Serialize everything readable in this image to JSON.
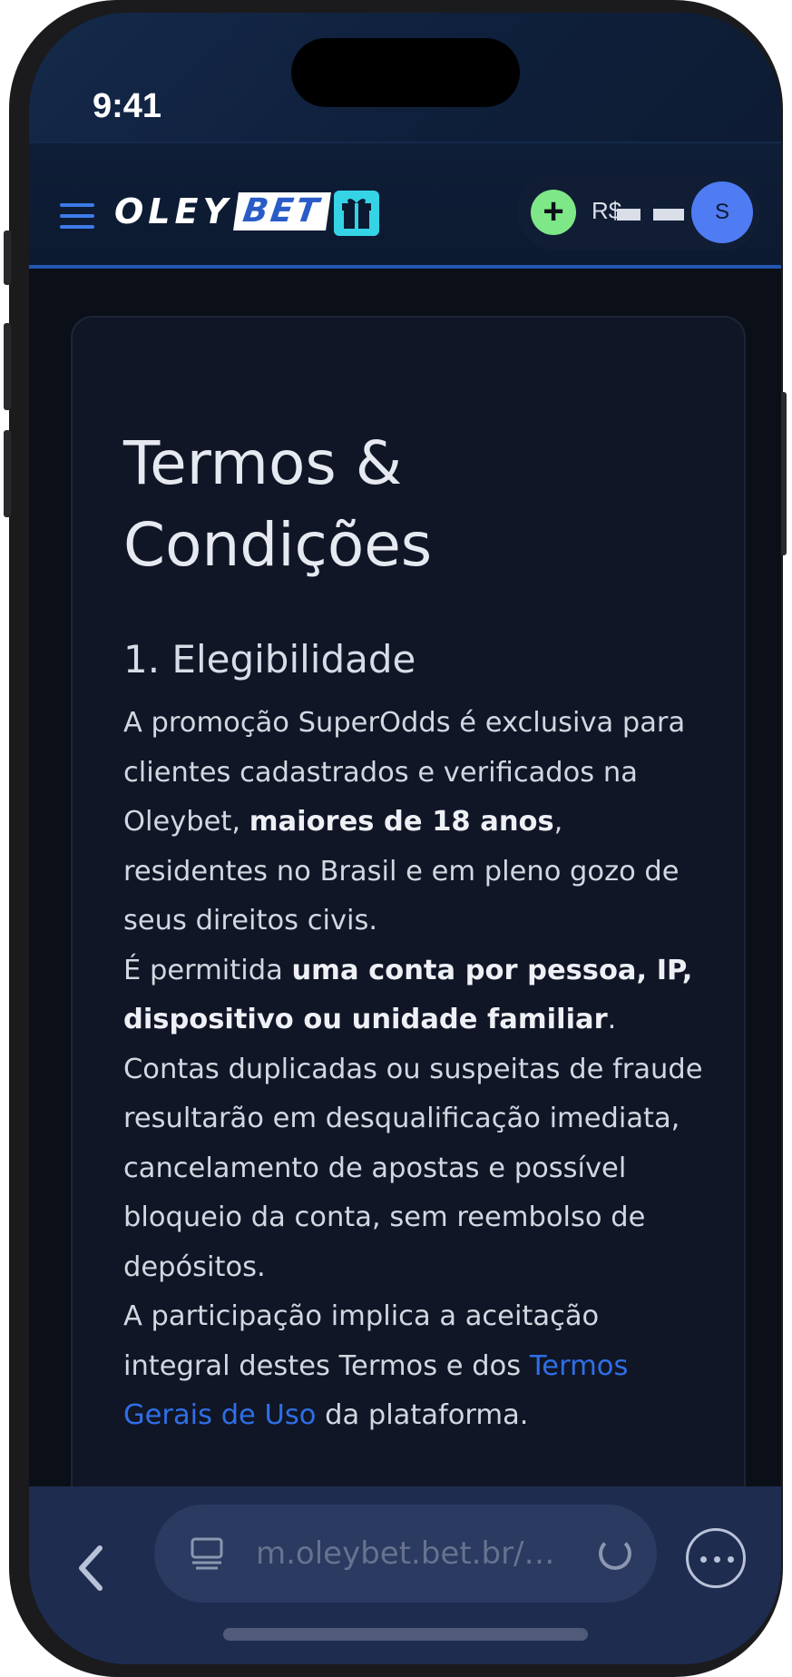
{
  "status": {
    "time": "9:41"
  },
  "header": {
    "logo_left": "OLEY",
    "logo_right": "BET",
    "deposit_symbol": "+",
    "currency": "R$",
    "avatar_initial": "S"
  },
  "page": {
    "title": "Termos & Condições",
    "section1": {
      "heading": "1. Elegibilidade",
      "p1_a": "A promoção SuperOdds é exclusiva para clientes cadastrados e verificados na Oleybet, ",
      "p1_b": "maiores de 18 anos",
      "p1_c": ", residentes no Brasil e em pleno gozo de seus direitos civis.",
      "p2_a": "É permitida ",
      "p2_b": "uma conta por pessoa, IP, dispositivo ou unidade familiar",
      "p2_c": ". Contas duplicadas ou suspeitas de fraude resultarão em desqualificação imediata, cancelamento de apostas e possível bloqueio da conta, sem reembolso de depósitos.",
      "p3_a": "A participação implica a aceitação integral destes Termos e dos ",
      "p3_link": "Termos Gerais de Uso",
      "p3_c": " da plataforma."
    }
  },
  "browser": {
    "url": "m.oleybet.bet.br/…"
  },
  "colors": {
    "accent": "#2f6fe6",
    "deposit": "#7ee787",
    "avatar": "#4f7cf3",
    "gift": "#35d3e6"
  },
  "icons": [
    "menu-icon",
    "gift-icon",
    "plus-icon",
    "back-icon",
    "tabs-icon",
    "reload-icon",
    "more-icon"
  ]
}
